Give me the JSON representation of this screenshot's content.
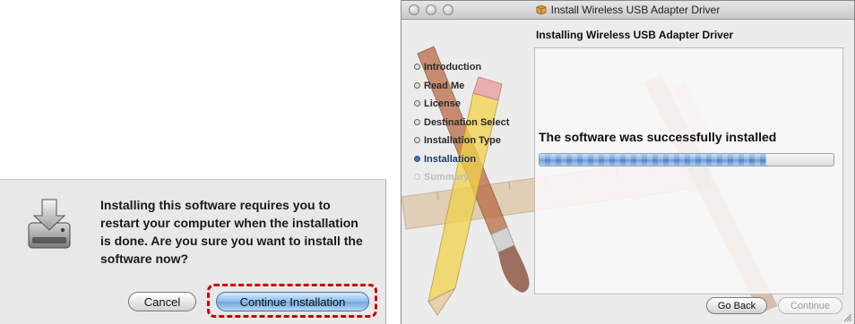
{
  "alert": {
    "message": "Installing this software requires you to restart your computer when the installation is done. Are you sure you want to install the software now?",
    "icon": "disk-install-icon",
    "cancel_label": "Cancel",
    "continue_label": "Continue Installation",
    "highlight_color": "#cc0000"
  },
  "installer": {
    "window_title": "Install Wireless USB Adapter Driver",
    "header_title": "Installing Wireless USB Adapter Driver",
    "steps": [
      {
        "label": "Introduction",
        "state": "done"
      },
      {
        "label": "Read Me",
        "state": "done"
      },
      {
        "label": "License",
        "state": "done"
      },
      {
        "label": "Destination Select",
        "state": "done"
      },
      {
        "label": "Installation Type",
        "state": "done"
      },
      {
        "label": "Installation",
        "state": "current"
      },
      {
        "label": "Summary",
        "state": "pending"
      }
    ],
    "status_text": "The software was successfully installed",
    "progress_fraction": 0.77,
    "back_label": "Go Back",
    "continue_label": "Continue",
    "accent_color": "#4f86cf"
  }
}
